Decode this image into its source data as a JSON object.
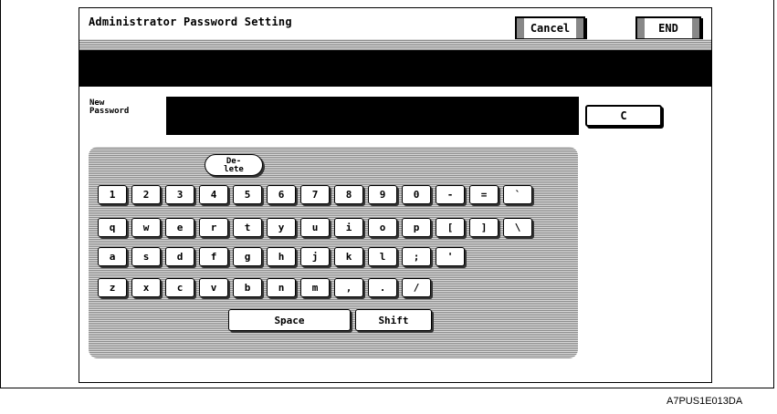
{
  "screen": {
    "title": "Administrator Password Setting",
    "cancel_label": "Cancel",
    "end_label": "END"
  },
  "password": {
    "label": "New\nPassword",
    "value": "",
    "clear_label": "C"
  },
  "keyboard": {
    "delete_label": "De-\nlete",
    "rows": [
      [
        "1",
        "2",
        "3",
        "4",
        "5",
        "6",
        "7",
        "8",
        "9",
        "0",
        "-",
        "=",
        "`"
      ],
      [
        "q",
        "w",
        "e",
        "r",
        "t",
        "y",
        "u",
        "i",
        "o",
        "p",
        "[",
        "]",
        "\\"
      ],
      [
        "a",
        "s",
        "d",
        "f",
        "g",
        "h",
        "j",
        "k",
        "l",
        ";",
        "'"
      ],
      [
        "z",
        "x",
        "c",
        "v",
        "b",
        "n",
        "m",
        ",",
        ".",
        "/"
      ]
    ],
    "space_label": "Space",
    "shift_label": "Shift"
  },
  "figure_code": "A7PUS1E013DA"
}
